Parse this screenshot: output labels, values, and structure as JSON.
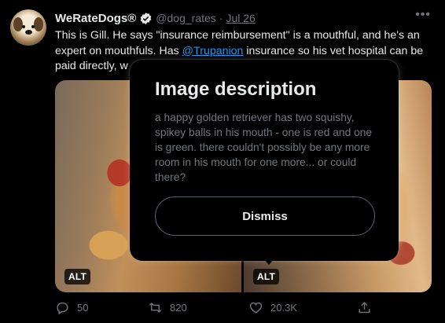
{
  "tweet": {
    "display_name": "WeRateDogs®",
    "handle": "@dog_rates",
    "separator": "·",
    "date": "Jul 26",
    "more_label": "•••",
    "text_before_mention": "This is Gill. He says \"insurance reimbursement\" is a mouthful, and he's an expert on mouthfuls. Has ",
    "mention": "@Trupanion",
    "text_after_mention": " insurance so his vet hospital can be paid directly, w"
  },
  "media": {
    "alt_badge_left": "ALT",
    "alt_badge_right": "ALT"
  },
  "popup": {
    "title": "Image description",
    "description": "a happy golden retriever has two squishy, spikey balls in his mouth - one is red and one is green. there couldn't possibly be any more room in his mouth for one more... or could there?",
    "dismiss_label": "Dismiss"
  },
  "actions": {
    "reply_count": "50",
    "retweet_count": "820",
    "like_count": "20.3K"
  },
  "colors": {
    "background": "#000000",
    "text": "#e7e9ea",
    "secondary": "#71767b",
    "link": "#1d9bf0"
  },
  "icons": {
    "verified": "verified-badge-icon",
    "reply": "reply-bubble-icon",
    "retweet": "retweet-icon",
    "like": "heart-icon",
    "share": "share-upload-icon",
    "more": "more-dots-icon"
  }
}
